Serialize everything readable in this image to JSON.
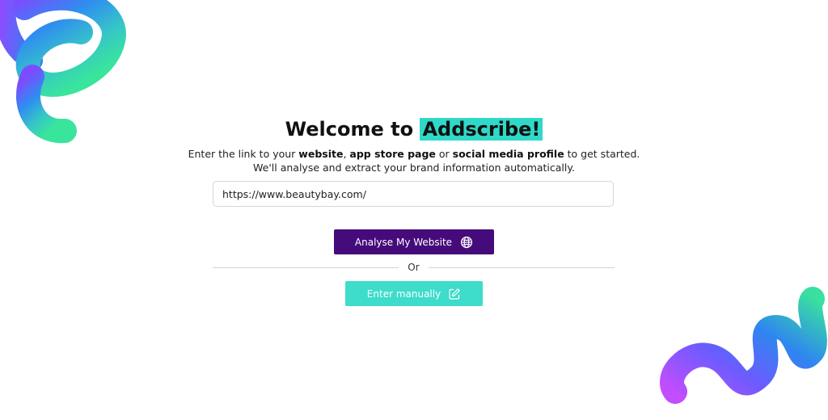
{
  "header": {
    "title_prefix": "Welcome to ",
    "title_brand": "Addscribe!"
  },
  "intro": {
    "line1_a": "Enter the link to your ",
    "line1_website": "website",
    "line1_b": ", ",
    "line1_appstore": "app store page",
    "line1_c": " or ",
    "line1_social": "social media profile",
    "line1_d": " to get started.",
    "line2": "We'll analyse and extract your brand information automatically."
  },
  "url_input": {
    "value": "https://www.beautybay.com/"
  },
  "buttons": {
    "analyse_label": "Analyse My Website",
    "analyse_icon": "globe-icon",
    "manual_label": "Enter manually",
    "manual_icon": "edit-icon"
  },
  "divider": {
    "or_label": "Or"
  },
  "colors": {
    "primary": "#450b7a",
    "accent": "#3ddccb",
    "highlight": "#2fd9c8"
  }
}
